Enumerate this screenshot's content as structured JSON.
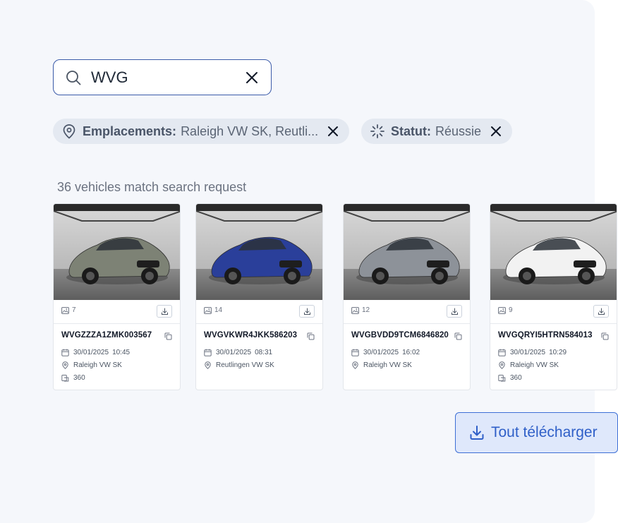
{
  "search": {
    "value": "WVG",
    "icon": "search-icon",
    "clear_icon": "close-icon"
  },
  "filters": [
    {
      "label": "Emplacements:",
      "value": "Raleigh VW SK, Reutli...",
      "icon": "location-pin-icon"
    },
    {
      "label": "Statut:",
      "value": "Réussie",
      "icon": "loading-spinner-icon"
    }
  ],
  "results_count": "36 vehicles match search request",
  "vehicles": [
    {
      "image_count": "7",
      "vin": "WVGZZZA1ZMK003567",
      "date": "30/01/2025",
      "time": "10:45",
      "location": "Raleigh VW SK",
      "spin": "360",
      "car_color": "#7d8275"
    },
    {
      "image_count": "14",
      "vin": "WVGVKWR4JKK586203",
      "date": "30/01/2025",
      "time": "08:31",
      "location": "Reutlingen VW SK",
      "spin": "",
      "car_color": "#2a3f9a"
    },
    {
      "image_count": "12",
      "vin": "WVGBVDD9TCM6846820",
      "date": "30/01/2025",
      "time": "16:02",
      "location": "Raleigh VW SK",
      "spin": "",
      "car_color": "#8d9299"
    },
    {
      "image_count": "9",
      "vin": "WVGQRYI5HTRN584013",
      "date": "30/01/2025",
      "time": "10:29",
      "location": "Raleigh VW SK",
      "spin": "360",
      "car_color": "#f2f2f2"
    }
  ],
  "download_all": {
    "label": "Tout télécharger",
    "icon": "download-icon"
  }
}
